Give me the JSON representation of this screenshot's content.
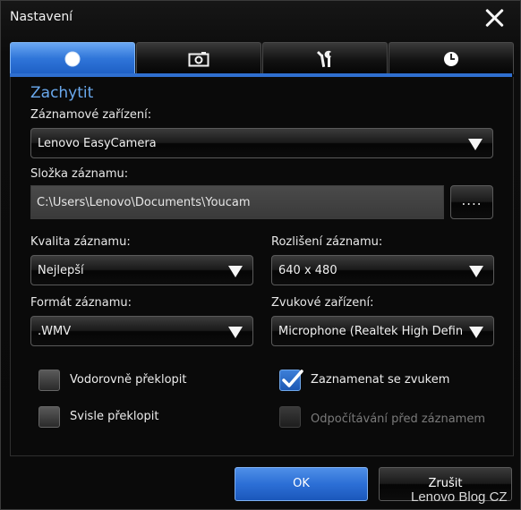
{
  "window": {
    "title": "Nastavení"
  },
  "tabs": [
    {
      "icon": "record-icon",
      "active": true
    },
    {
      "icon": "camera-icon",
      "active": false
    },
    {
      "icon": "tools-icon",
      "active": false
    },
    {
      "icon": "clock-icon",
      "active": false
    }
  ],
  "capture": {
    "section_title": "Zachytit",
    "device_label": "Záznamové zařízení:",
    "device_value": "Lenovo EasyCamera",
    "folder_label": "Složka záznamu:",
    "folder_value": "C:\\Users\\Lenovo\\Documents\\Youcam",
    "browse_label": "....",
    "quality_label": "Kvalita záznamu:",
    "quality_value": "Nejlepší",
    "resolution_label": "Rozlišení záznamu:",
    "resolution_value": "640 x 480",
    "format_label": "Formát záznamu:",
    "format_value": ".WMV",
    "audio_label": "Zvukové zařízení:",
    "audio_value": "Microphone (Realtek High Definiti"
  },
  "checkboxes": {
    "flip_h": {
      "label": "Vodorovně překlopit",
      "checked": false
    },
    "flip_v": {
      "label": "Svisle překlopit",
      "checked": false
    },
    "with_audio": {
      "label": "Zaznamenat se zvukem",
      "checked": true
    },
    "countdown": {
      "label": "Odpočítávání před záznamem",
      "checked": false,
      "disabled": true
    }
  },
  "buttons": {
    "ok": "OK",
    "cancel": "Zrušit"
  },
  "watermark": "Lenovo Blog CZ",
  "colors": {
    "accent": "#2f75d9",
    "section_title": "#6aa9ee",
    "disabled_text": "#7a7a7a"
  }
}
